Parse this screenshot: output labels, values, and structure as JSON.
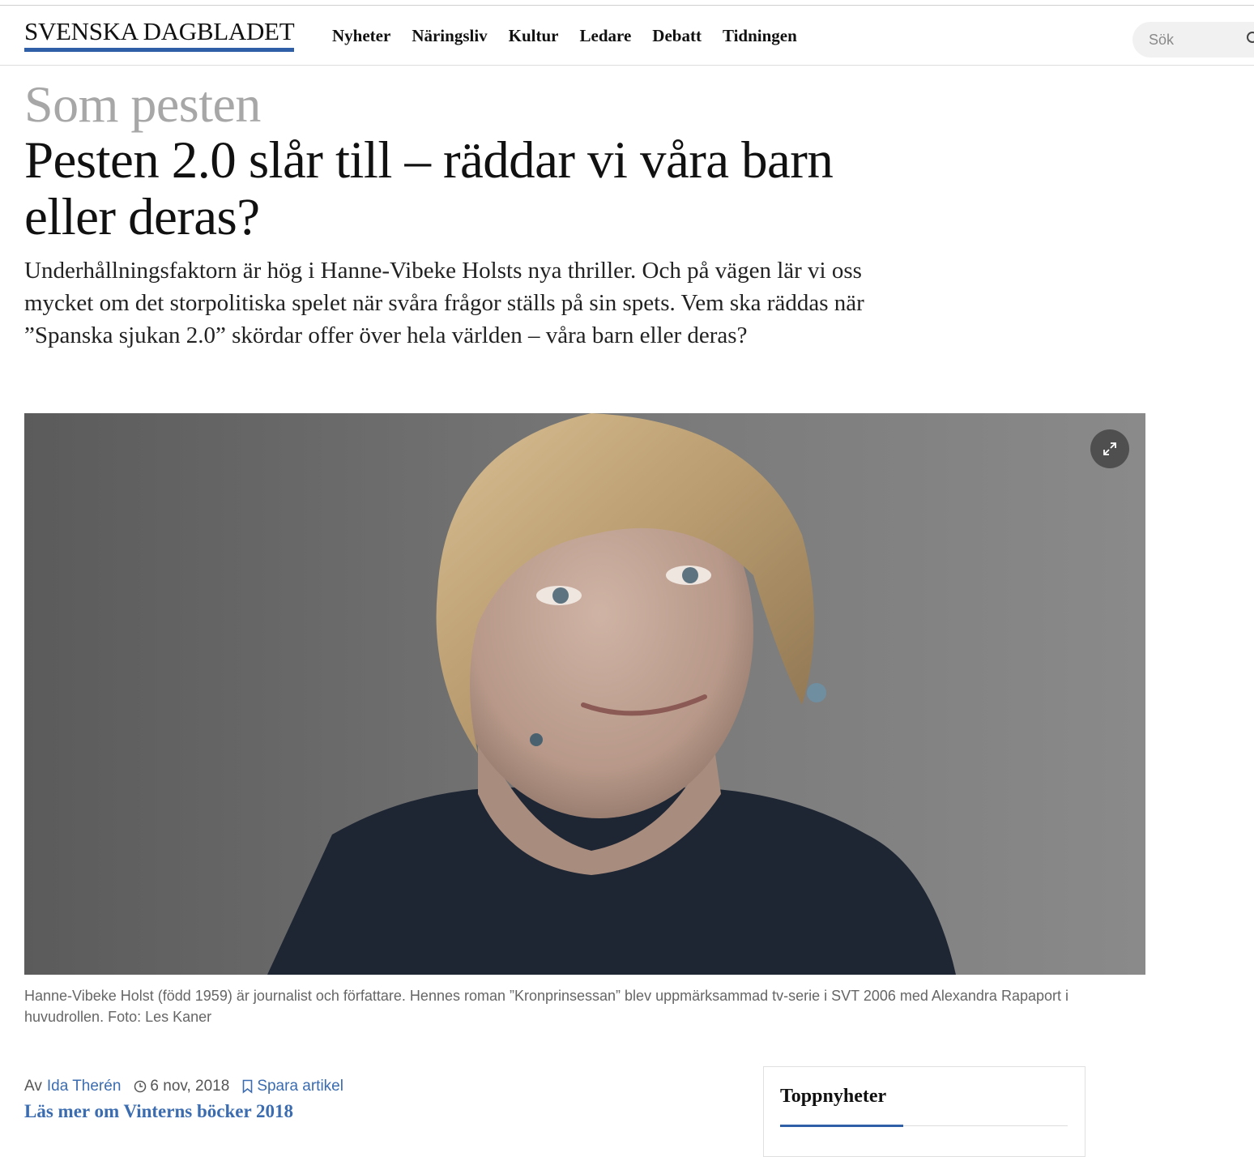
{
  "header": {
    "logo": "SVENSKA DAGBLADET",
    "nav": [
      "Nyheter",
      "Näringsliv",
      "Kultur",
      "Ledare",
      "Debatt",
      "Tidningen"
    ],
    "search_placeholder": "Sök",
    "accent_color": "#2f5fa6"
  },
  "article": {
    "kicker": "Som pesten",
    "headline": "Pesten 2.0 slår till – räddar vi våra barn eller deras?",
    "lead": "Underhållningsfaktorn är hög i Hanne-Vibeke Holsts nya thriller. Och på vägen lär vi oss mycket om det storpolitiska spelet när svåra frågor ställs på sin spets. Vem ska räddas när ”Spanska sjukan 2.0” skördar offer över hela världen – våra barn eller deras?",
    "caption": "Hanne-Vibeke Holst (född 1959) är journalist och författare. Hennes roman ”Kronprinsessan” blev uppmärksammad tv-serie i SVT 2006 med Alexandra Rapaport i huvudrollen. Foto: Les Kaner",
    "byline_prefix": "Av",
    "author": "Ida Therén",
    "date": "6 nov, 2018",
    "save_label": "Spara artikel",
    "read_more": "Läs mer om Vinterns böcker 2018",
    "link_color": "#3b6cb0"
  },
  "sidebar": {
    "title": "Toppnyheter"
  },
  "icons": {
    "expand": "expand-icon",
    "clock": "clock-icon",
    "bookmark": "bookmark-icon",
    "search": "search-icon"
  }
}
